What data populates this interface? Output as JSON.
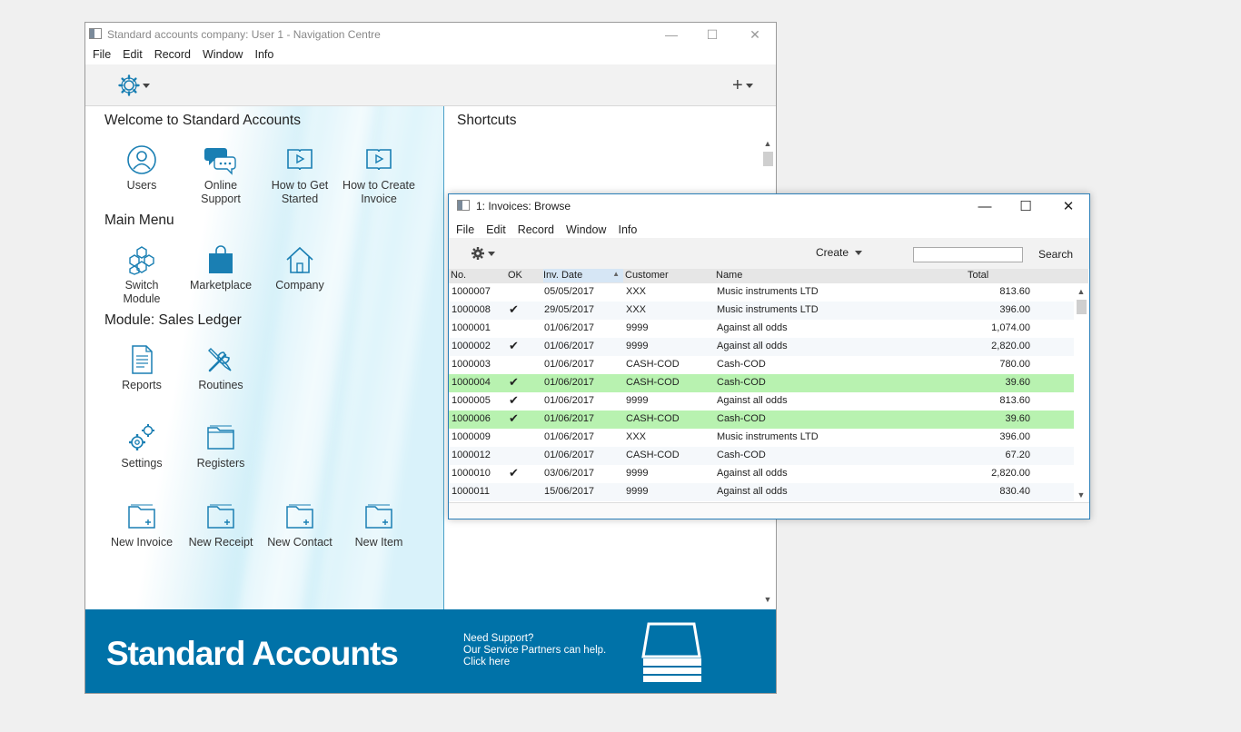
{
  "nav_window": {
    "title": "Standard accounts company: User 1 - Navigation Centre",
    "menu": [
      "File",
      "Edit",
      "Record",
      "Window",
      "Info"
    ],
    "welcome_heading": "Welcome to Standard Accounts",
    "welcome_tiles": [
      {
        "label": "Users",
        "icon": "user-icon"
      },
      {
        "label": "Online Support",
        "icon": "chat-icon"
      },
      {
        "label": "How to Get Started",
        "icon": "video-book-icon"
      },
      {
        "label": "How to Create Invoice",
        "icon": "video-book-icon"
      }
    ],
    "main_menu_heading": "Main Menu",
    "main_menu_tiles": [
      {
        "label": "Switch Module",
        "icon": "hexagons-icon"
      },
      {
        "label": "Marketplace",
        "icon": "shopping-bag-icon"
      },
      {
        "label": "Company",
        "icon": "home-icon"
      }
    ],
    "module_heading": "Module:  Sales Ledger",
    "module_tiles": [
      {
        "label": "Reports",
        "icon": "report-icon"
      },
      {
        "label": "Routines",
        "icon": "tools-icon"
      },
      {
        "label": "Settings",
        "icon": "gears-icon"
      },
      {
        "label": "Registers",
        "icon": "folder-icon"
      },
      {
        "label": "New Invoice",
        "icon": "new-folder-icon"
      },
      {
        "label": "New Receipt",
        "icon": "new-folder-icon"
      },
      {
        "label": "New Contact",
        "icon": "new-folder-icon"
      },
      {
        "label": "New Item",
        "icon": "new-folder-icon"
      }
    ],
    "shortcuts_heading": "Shortcuts",
    "banner": {
      "brand": "Standard Accounts",
      "support_line1": "Need Support?",
      "support_line2": "Our Service Partners can help.",
      "support_line3": "Click here"
    }
  },
  "invoice_window": {
    "title": "1: Invoices: Browse",
    "menu": [
      "File",
      "Edit",
      "Record",
      "Window",
      "Info"
    ],
    "create_label": "Create",
    "search_label": "Search",
    "search_value": "",
    "columns": [
      "No.",
      "OK",
      "Inv. Date",
      "Customer",
      "Name",
      "Total"
    ],
    "sorted_column": "Inv. Date",
    "rows": [
      {
        "no": "1000007",
        "ok": "",
        "date": "05/05/2017",
        "customer": "XXX",
        "name": "Music instruments LTD",
        "total": "813.60",
        "highlight": false
      },
      {
        "no": "1000008",
        "ok": "✔",
        "date": "29/05/2017",
        "customer": "XXX",
        "name": "Music instruments LTD",
        "total": "396.00",
        "highlight": false
      },
      {
        "no": "1000001",
        "ok": "",
        "date": "01/06/2017",
        "customer": "9999",
        "name": "Against all odds",
        "total": "1,074.00",
        "highlight": false
      },
      {
        "no": "1000002",
        "ok": "✔",
        "date": "01/06/2017",
        "customer": "9999",
        "name": "Against all odds",
        "total": "2,820.00",
        "highlight": false
      },
      {
        "no": "1000003",
        "ok": "",
        "date": "01/06/2017",
        "customer": "CASH-COD",
        "name": "Cash-COD",
        "total": "780.00",
        "highlight": false
      },
      {
        "no": "1000004",
        "ok": "✔",
        "date": "01/06/2017",
        "customer": "CASH-COD",
        "name": "Cash-COD",
        "total": "39.60",
        "highlight": true
      },
      {
        "no": "1000005",
        "ok": "✔",
        "date": "01/06/2017",
        "customer": "9999",
        "name": "Against all odds",
        "total": "813.60",
        "highlight": false
      },
      {
        "no": "1000006",
        "ok": "✔",
        "date": "01/06/2017",
        "customer": "CASH-COD",
        "name": "Cash-COD",
        "total": "39.60",
        "highlight": true
      },
      {
        "no": "1000009",
        "ok": "",
        "date": "01/06/2017",
        "customer": "XXX",
        "name": "Music instruments LTD",
        "total": "396.00",
        "highlight": false
      },
      {
        "no": "1000012",
        "ok": "",
        "date": "01/06/2017",
        "customer": "CASH-COD",
        "name": "Cash-COD",
        "total": "67.20",
        "highlight": false
      },
      {
        "no": "1000010",
        "ok": "✔",
        "date": "03/06/2017",
        "customer": "9999",
        "name": "Against all odds",
        "total": "2,820.00",
        "highlight": false
      },
      {
        "no": "1000011",
        "ok": "",
        "date": "15/06/2017",
        "customer": "9999",
        "name": "Against all odds",
        "total": "830.40",
        "highlight": false
      }
    ]
  },
  "colors": {
    "accent": "#1a7fb3",
    "banner": "#0072a8",
    "row_highlight": "#b8f2b0"
  }
}
